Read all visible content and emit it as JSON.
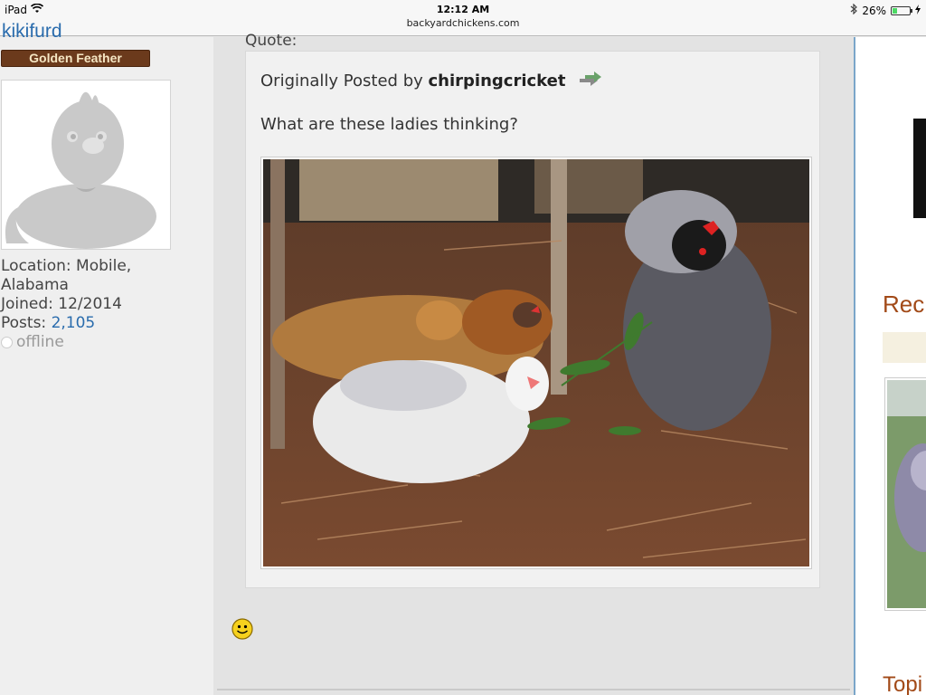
{
  "status_bar": {
    "device": "iPad",
    "time": "12:12 AM",
    "url": "backyardchickens.com",
    "battery": "26%",
    "battery_level": 0.26
  },
  "user_panel": {
    "username": "kikifurd",
    "rank_badge": "Golden Feather",
    "location_line1": "Location: Mobile,",
    "location_line2": "Alabama",
    "joined": "Joined: 12/2014",
    "posts_label": "Posts: ",
    "posts_value": "2,105",
    "status": "offline"
  },
  "post": {
    "quote_label": "Quote:",
    "origin_prefix": "Originally Posted by ",
    "origin_author": "chirpingcricket",
    "quote_text": "What are these ladies thinking?"
  },
  "sidebar": {
    "heading_recent": "Rec",
    "heading_topics": "Topi"
  },
  "icons": {
    "wifi": "wifi-icon",
    "bluetooth": "bluetooth-icon",
    "battery": "battery-icon",
    "view_post": "view-post-arrow-icon",
    "smiley": "smiley-icon",
    "status_dot": "offline-dot-icon"
  },
  "colors": {
    "link": "#2a6cad",
    "badge_bg": "#6b3a1c",
    "sidebar_heading": "#a24a18"
  }
}
